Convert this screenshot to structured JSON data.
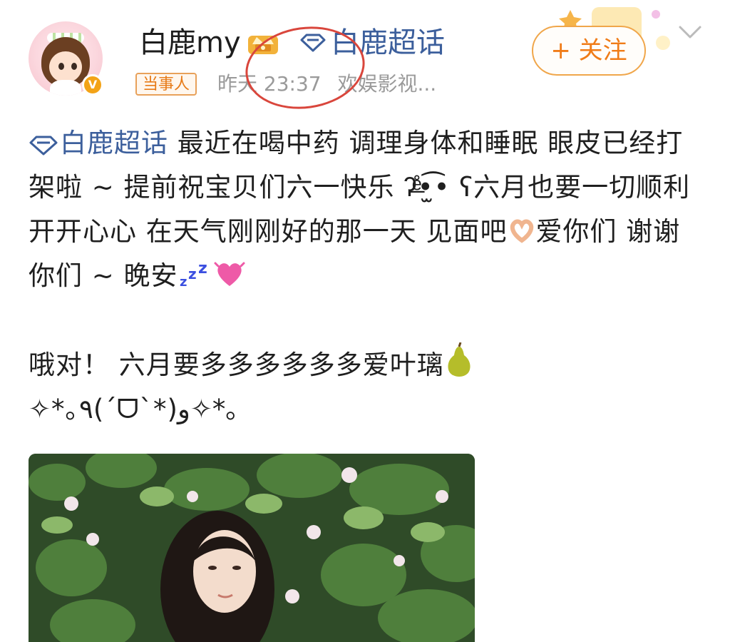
{
  "author": {
    "name": "白鹿my",
    "role_badge": "当事人",
    "avatar_label": "V"
  },
  "topic": {
    "name": "白鹿超话"
  },
  "meta": {
    "time": "昨天 23:37",
    "source": "欢娱影视..."
  },
  "actions": {
    "follow_label": "+ 关注"
  },
  "post": {
    "topic": "白鹿超话",
    "line1": " 最近在喝中药 调理身体和睡眠 眼皮已经打架啦 ~ 提前祝宝贝们六一快乐 ʔ̶ͤ̊•̫͡• ʕ六月也要一切顺利 开开心心 在天气刚刚好的那一天 见面吧",
    "line2": "爱你们 谢谢你们 ~ 晚安",
    "line3": "哦对！ 六月要多多多多多多爱叶璃",
    "line4": "✧*｡٩(ˊᗜˋ*)و✧*｡"
  },
  "colors": {
    "link": "#3c5f9c",
    "follow": "#f07c18",
    "badge_border": "#e8a15a",
    "meta_text": "#9a9a9a",
    "annotation": "#d9463c"
  },
  "icons": {
    "topic": "diamond-icon",
    "level": "crown-badge-icon",
    "heart_hands": "heart-hands-emoji",
    "sleep": "zzz-emoji",
    "heart": "pink-heart-emoji",
    "pear": "pear-emoji",
    "more": "chevron-down-icon"
  }
}
